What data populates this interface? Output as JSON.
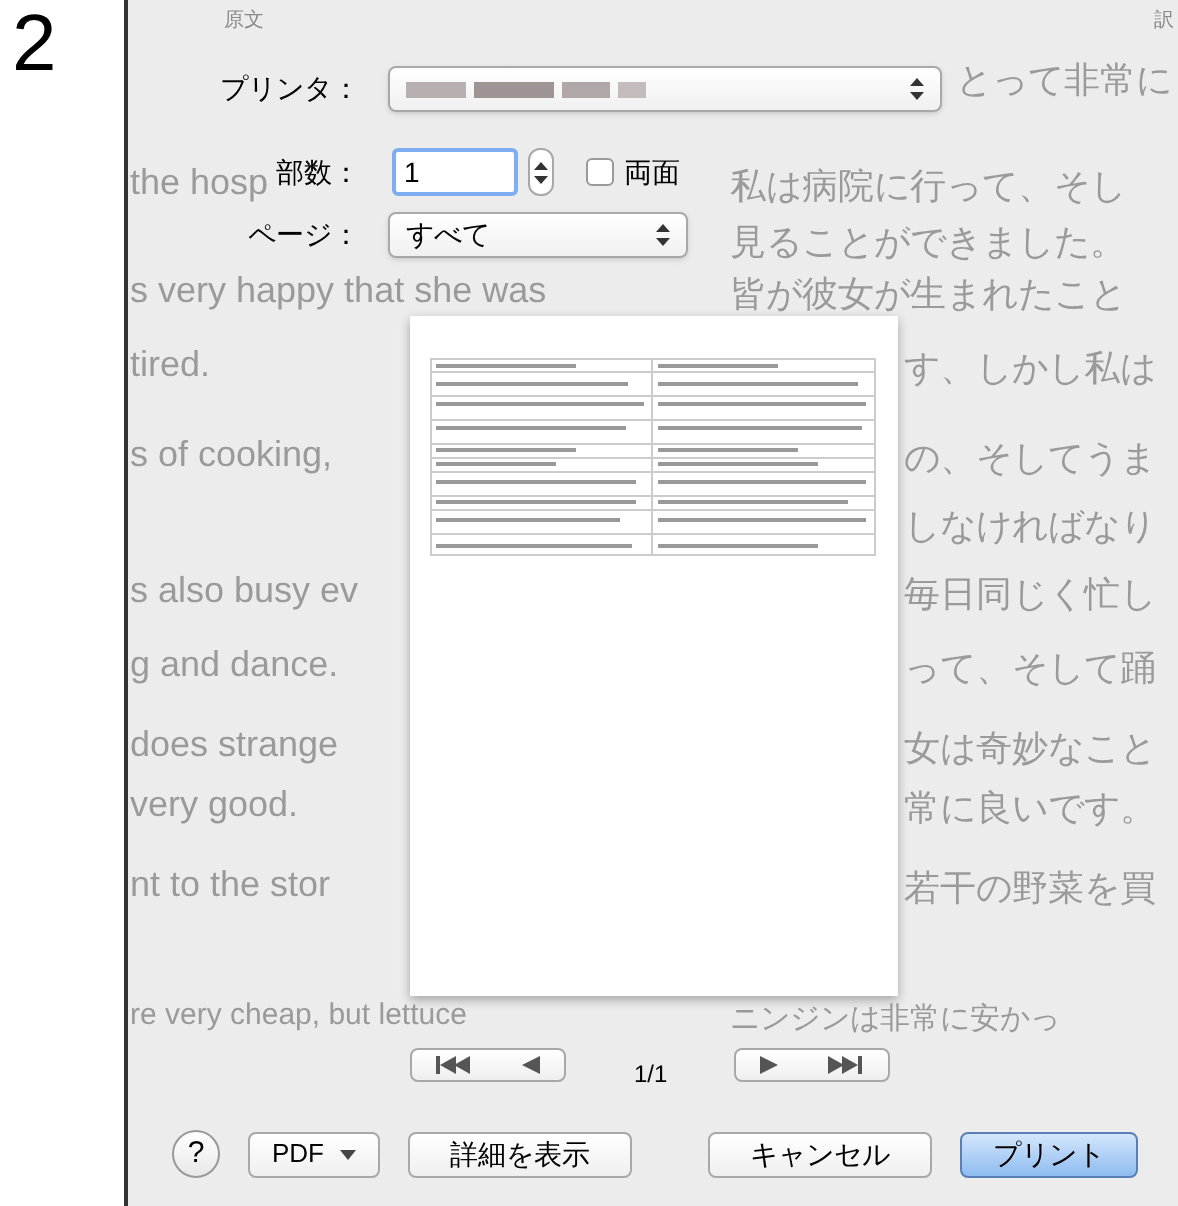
{
  "step_number": "2",
  "backdrop": {
    "headers": [
      "原文",
      "訳"
    ],
    "rows": [
      {
        "right": "とって非常に"
      },
      {
        "left": "the hosp",
        "right": "私は病院に行って、そし"
      },
      {
        "right": "見ることができました。"
      },
      {
        "left": "s very happy that she was",
        "right": "皆が彼女が生まれたこと"
      },
      {
        "left": "tired.",
        "right": "す、しかし私は"
      },
      {
        "left": "s of cooking,",
        "right": "の、そしてうま"
      },
      {
        "right": "しなければなり"
      },
      {
        "left": "s also busy ev",
        "right": "毎日同じく忙し"
      },
      {
        "left": "g and dance.",
        "right": "って、そして踊"
      },
      {
        "left": "does strange",
        "right": "女は奇妙なこと"
      },
      {
        "left": "very good.",
        "right": "常に良いです。"
      },
      {
        "left": "nt to the stor",
        "right": "若干の野菜を買"
      },
      {
        "left": "re very cheap, but lettuce",
        "right": "ニンジンは非常に安かっ"
      }
    ]
  },
  "dialog": {
    "printer": {
      "label": "プリンタ："
    },
    "copies": {
      "label": "部数：",
      "value": "1"
    },
    "two_sided": {
      "label": "両面",
      "checked": false
    },
    "pages": {
      "label": "ページ：",
      "value": "すべて"
    },
    "page_indicator": "1/1",
    "buttons": [
      {
        "kind": "help",
        "label": "?"
      },
      {
        "kind": "menu",
        "label": "PDF"
      },
      {
        "kind": "plain",
        "label": "詳細を表示"
      },
      {
        "kind": "plain",
        "label": "キャンセル"
      },
      {
        "kind": "default",
        "label": "プリント"
      }
    ]
  }
}
